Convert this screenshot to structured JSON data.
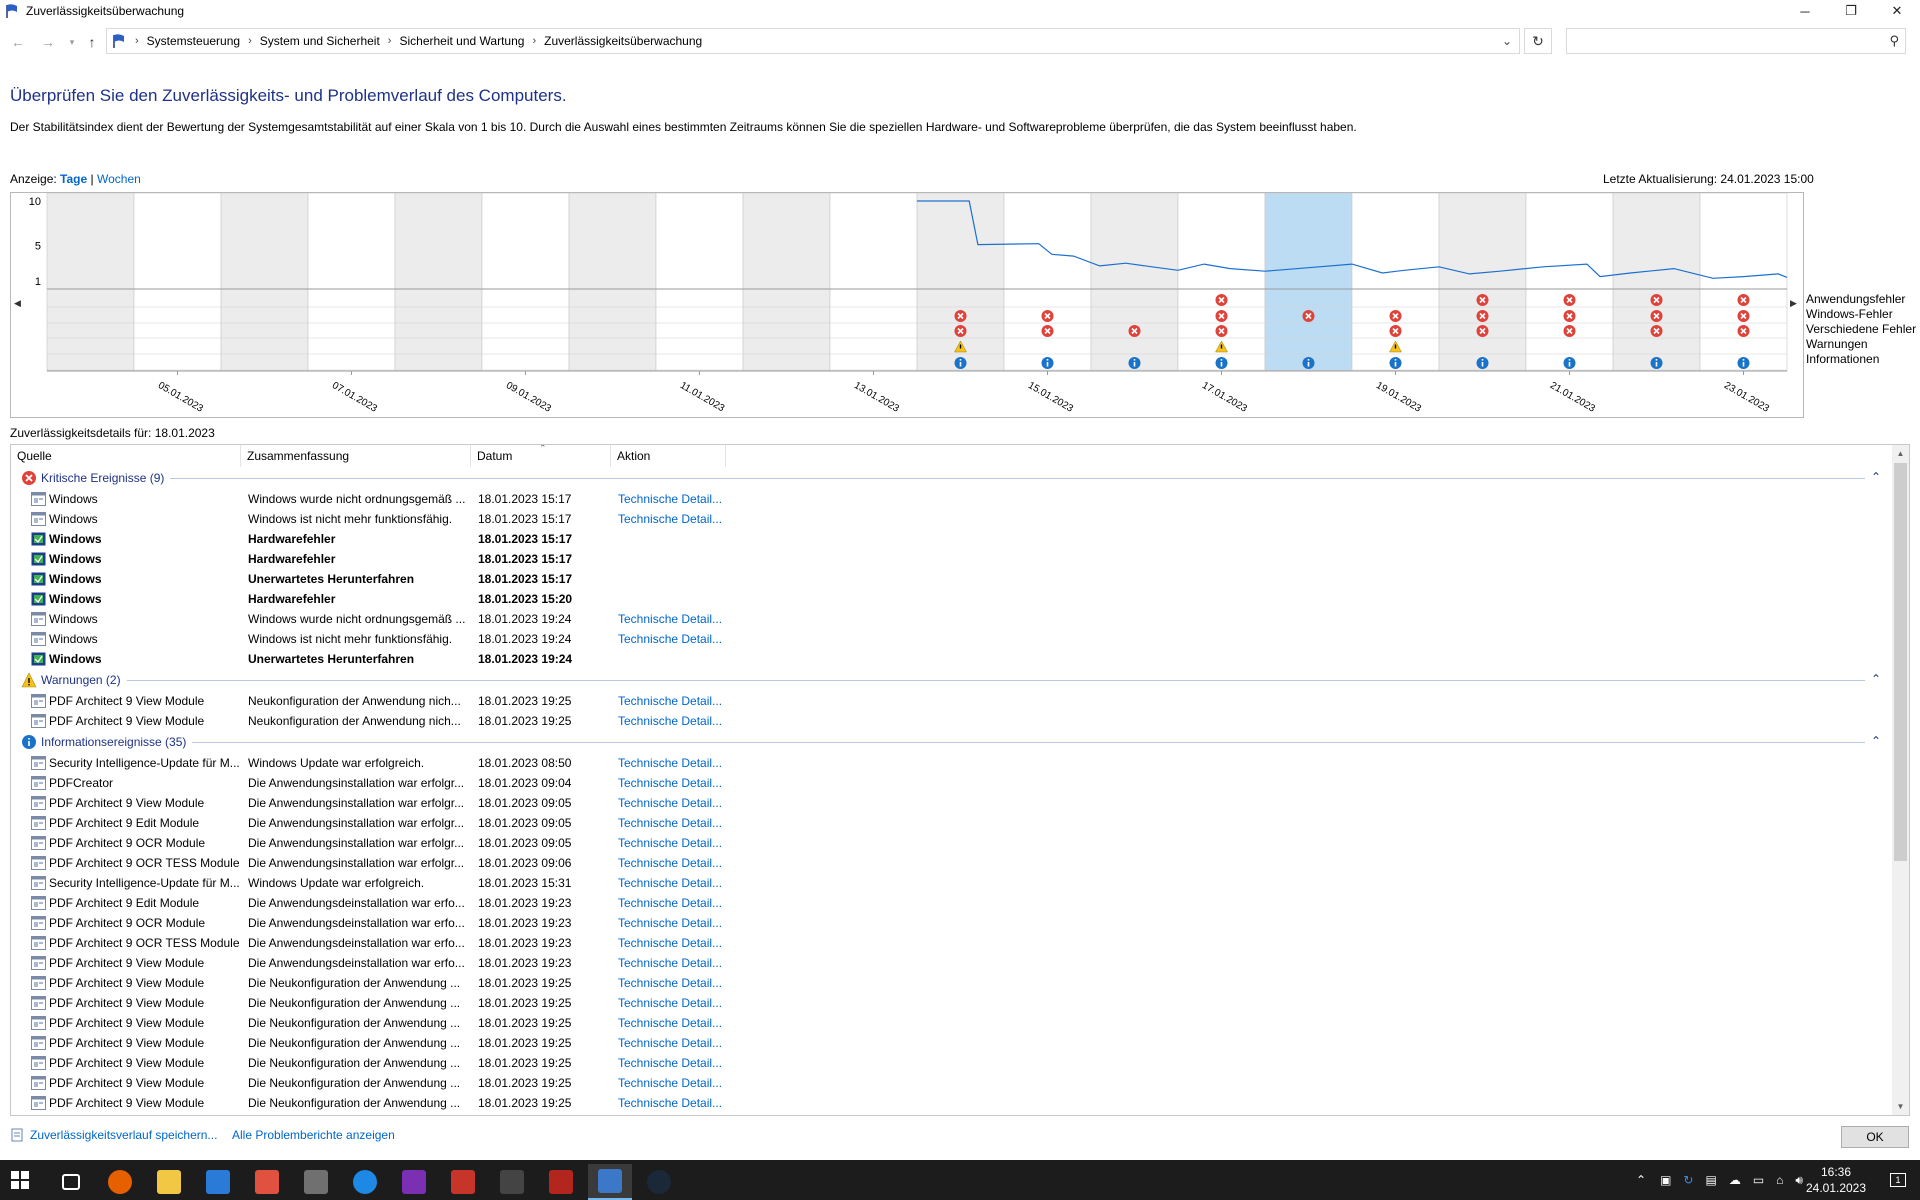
{
  "window": {
    "title": "Zuverlässigkeitsüberwachung",
    "minimize": "─",
    "maximize": "❐",
    "close": "✕"
  },
  "address": {
    "crumbs": [
      "Systemsteuerung",
      "System und Sicherheit",
      "Sicherheit und Wartung",
      "Zuverlässigkeitsüberwachung"
    ],
    "sep": "›",
    "search_placeholder": ""
  },
  "page": {
    "heading": "Überprüfen Sie den Zuverlässigkeits- und Problemverlauf des Computers.",
    "description": "Der Stabilitätsindex dient der Bewertung der Systemgesamtstabilität auf einer Skala von 1 bis 10. Durch die Auswahl eines bestimmten Zeitraums können Sie die speziellen Hardware- und Softwareprobleme überprüfen, die das System beeinflusst haben.",
    "view_label": "Anzeige:",
    "view_days": "Tage",
    "view_sep": "|",
    "view_weeks": "Wochen",
    "last_update": "Letzte Aktualisierung: 24.01.2023 15:00",
    "details_for": "Zuverlässigkeitsdetails für: 18.01.2023"
  },
  "chart_data": {
    "type": "line",
    "title": "",
    "y_ticks": [
      "10",
      "5",
      "1"
    ],
    "ylim": [
      1,
      10
    ],
    "date_labels": [
      "05.01.2023",
      "07.01.2023",
      "09.01.2023",
      "11.01.2023",
      "13.01.2023",
      "15.01.2023",
      "17.01.2023",
      "19.01.2023",
      "21.01.2023",
      "23.01.2023"
    ],
    "days": [
      "04.01.2023",
      "05.01.2023",
      "06.01.2023",
      "07.01.2023",
      "08.01.2023",
      "09.01.2023",
      "10.01.2023",
      "11.01.2023",
      "12.01.2023",
      "13.01.2023",
      "14.01.2023",
      "15.01.2023",
      "16.01.2023",
      "17.01.2023",
      "18.01.2023",
      "19.01.2023",
      "20.01.2023",
      "21.01.2023",
      "22.01.2023",
      "23.01.2023"
    ],
    "selected_day": "18.01.2023",
    "stability_series": {
      "name": "Stabilitätsindex",
      "points": [
        {
          "day": 10,
          "value": 10
        },
        {
          "day": 10.6,
          "value": 10
        },
        {
          "day": 10.7,
          "value": 5.1
        },
        {
          "day": 11.4,
          "value": 5.2
        },
        {
          "day": 11.55,
          "value": 4.0
        },
        {
          "day": 11.8,
          "value": 3.8
        },
        {
          "day": 12.1,
          "value": 2.7
        },
        {
          "day": 12.4,
          "value": 3.0
        },
        {
          "day": 12.7,
          "value": 2.6
        },
        {
          "day": 13.0,
          "value": 2.2
        },
        {
          "day": 13.3,
          "value": 2.9
        },
        {
          "day": 13.6,
          "value": 2.4
        },
        {
          "day": 14.0,
          "value": 2.1
        },
        {
          "day": 14.5,
          "value": 2.5
        },
        {
          "day": 15.0,
          "value": 2.9
        },
        {
          "day": 15.35,
          "value": 1.9
        },
        {
          "day": 15.6,
          "value": 2.2
        },
        {
          "day": 16.0,
          "value": 2.6
        },
        {
          "day": 16.35,
          "value": 1.8
        },
        {
          "day": 16.7,
          "value": 2.1
        },
        {
          "day": 17.2,
          "value": 2.6
        },
        {
          "day": 17.7,
          "value": 2.9
        },
        {
          "day": 17.85,
          "value": 1.5
        },
        {
          "day": 18.2,
          "value": 1.9
        },
        {
          "day": 18.7,
          "value": 2.4
        },
        {
          "day": 19.15,
          "value": 1.3
        },
        {
          "day": 19.5,
          "value": 1.5
        },
        {
          "day": 19.9,
          "value": 1.8
        },
        {
          "day": 20.0,
          "value": 1.4
        }
      ]
    },
    "legend": [
      "Anwendungsfehler",
      "Windows-Fehler",
      "Verschiedene Fehler",
      "Warnungen",
      "Informationen"
    ],
    "events": {
      "Anwendungsfehler": [
        13,
        16,
        17,
        18,
        19
      ],
      "Windows-Fehler": [
        10,
        11,
        13,
        14,
        15,
        16,
        17,
        18,
        19
      ],
      "Verschiedene Fehler": [
        10,
        11,
        12,
        13,
        15,
        16,
        17,
        18,
        19
      ],
      "Warnungen": [
        10,
        13,
        15
      ],
      "Informationen": [
        10,
        11,
        12,
        13,
        14,
        15,
        16,
        17,
        18,
        19
      ]
    }
  },
  "table": {
    "headers": {
      "source": "Quelle",
      "summary": "Zusammenfassung",
      "date": "Datum",
      "action": "Aktion"
    },
    "groups": [
      {
        "label": "Kritische Ereignisse (9)",
        "kind": "error",
        "rows": [
          {
            "source": "Windows",
            "summary": "Windows wurde nicht ordnungsgemäß ...",
            "date": "18.01.2023 15:17",
            "action": "Technische Detail...",
            "bold": false,
            "icon": "window"
          },
          {
            "source": "Windows",
            "summary": "Windows ist nicht mehr funktionsfähig.",
            "date": "18.01.2023 15:17",
            "action": "Technische Detail...",
            "bold": false,
            "icon": "window"
          },
          {
            "source": "Windows",
            "summary": "Hardwarefehler",
            "date": "18.01.2023 15:17",
            "action": "",
            "bold": true,
            "icon": "shield"
          },
          {
            "source": "Windows",
            "summary": "Hardwarefehler",
            "date": "18.01.2023 15:17",
            "action": "",
            "bold": true,
            "icon": "shield"
          },
          {
            "source": "Windows",
            "summary": "Unerwartetes Herunterfahren",
            "date": "18.01.2023 15:17",
            "action": "",
            "bold": true,
            "icon": "shield"
          },
          {
            "source": "Windows",
            "summary": "Hardwarefehler",
            "date": "18.01.2023 15:20",
            "action": "",
            "bold": true,
            "icon": "shield"
          },
          {
            "source": "Windows",
            "summary": "Windows wurde nicht ordnungsgemäß ...",
            "date": "18.01.2023 19:24",
            "action": "Technische Detail...",
            "bold": false,
            "icon": "window"
          },
          {
            "source": "Windows",
            "summary": "Windows ist nicht mehr funktionsfähig.",
            "date": "18.01.2023 19:24",
            "action": "Technische Detail...",
            "bold": false,
            "icon": "window"
          },
          {
            "source": "Windows",
            "summary": "Unerwartetes Herunterfahren",
            "date": "18.01.2023 19:24",
            "action": "",
            "bold": true,
            "icon": "shield"
          }
        ]
      },
      {
        "label": "Warnungen (2)",
        "kind": "warning",
        "rows": [
          {
            "source": "PDF Architect 9 View Module",
            "summary": "Neukonfiguration der Anwendung nich...",
            "date": "18.01.2023 19:25",
            "action": "Technische Detail...",
            "bold": false,
            "icon": "window"
          },
          {
            "source": "PDF Architect 9 View Module",
            "summary": "Neukonfiguration der Anwendung nich...",
            "date": "18.01.2023 19:25",
            "action": "Technische Detail...",
            "bold": false,
            "icon": "window"
          }
        ]
      },
      {
        "label": "Informationsereignisse (35)",
        "kind": "info",
        "rows": [
          {
            "source": "Security Intelligence-Update für M...",
            "summary": "Windows Update war erfolgreich.",
            "date": "18.01.2023 08:50",
            "action": "Technische Detail...",
            "bold": false,
            "icon": "window"
          },
          {
            "source": "PDFCreator",
            "summary": "Die Anwendungsinstallation war erfolgr...",
            "date": "18.01.2023 09:04",
            "action": "Technische Detail...",
            "bold": false,
            "icon": "window"
          },
          {
            "source": "PDF Architect 9 View Module",
            "summary": "Die Anwendungsinstallation war erfolgr...",
            "date": "18.01.2023 09:05",
            "action": "Technische Detail...",
            "bold": false,
            "icon": "window"
          },
          {
            "source": "PDF Architect 9 Edit Module",
            "summary": "Die Anwendungsinstallation war erfolgr...",
            "date": "18.01.2023 09:05",
            "action": "Technische Detail...",
            "bold": false,
            "icon": "window"
          },
          {
            "source": "PDF Architect 9 OCR Module",
            "summary": "Die Anwendungsinstallation war erfolgr...",
            "date": "18.01.2023 09:05",
            "action": "Technische Detail...",
            "bold": false,
            "icon": "window"
          },
          {
            "source": "PDF Architect 9 OCR TESS Module",
            "summary": "Die Anwendungsinstallation war erfolgr...",
            "date": "18.01.2023 09:06",
            "action": "Technische Detail...",
            "bold": false,
            "icon": "window"
          },
          {
            "source": "Security Intelligence-Update für M...",
            "summary": "Windows Update war erfolgreich.",
            "date": "18.01.2023 15:31",
            "action": "Technische Detail...",
            "bold": false,
            "icon": "window"
          },
          {
            "source": "PDF Architect 9 Edit Module",
            "summary": "Die Anwendungsdeinstallation war erfo...",
            "date": "18.01.2023 19:23",
            "action": "Technische Detail...",
            "bold": false,
            "icon": "window"
          },
          {
            "source": "PDF Architect 9 OCR Module",
            "summary": "Die Anwendungsdeinstallation war erfo...",
            "date": "18.01.2023 19:23",
            "action": "Technische Detail...",
            "bold": false,
            "icon": "window"
          },
          {
            "source": "PDF Architect 9 OCR TESS Module",
            "summary": "Die Anwendungsdeinstallation war erfo...",
            "date": "18.01.2023 19:23",
            "action": "Technische Detail...",
            "bold": false,
            "icon": "window"
          },
          {
            "source": "PDF Architect 9 View Module",
            "summary": "Die Anwendungsdeinstallation war erfo...",
            "date": "18.01.2023 19:23",
            "action": "Technische Detail...",
            "bold": false,
            "icon": "window"
          },
          {
            "source": "PDF Architect 9 View Module",
            "summary": "Die Neukonfiguration der Anwendung ...",
            "date": "18.01.2023 19:25",
            "action": "Technische Detail...",
            "bold": false,
            "icon": "window"
          },
          {
            "source": "PDF Architect 9 View Module",
            "summary": "Die Neukonfiguration der Anwendung ...",
            "date": "18.01.2023 19:25",
            "action": "Technische Detail...",
            "bold": false,
            "icon": "window"
          },
          {
            "source": "PDF Architect 9 View Module",
            "summary": "Die Neukonfiguration der Anwendung ...",
            "date": "18.01.2023 19:25",
            "action": "Technische Detail...",
            "bold": false,
            "icon": "window"
          },
          {
            "source": "PDF Architect 9 View Module",
            "summary": "Die Neukonfiguration der Anwendung ...",
            "date": "18.01.2023 19:25",
            "action": "Technische Detail...",
            "bold": false,
            "icon": "window"
          },
          {
            "source": "PDF Architect 9 View Module",
            "summary": "Die Neukonfiguration der Anwendung ...",
            "date": "18.01.2023 19:25",
            "action": "Technische Detail...",
            "bold": false,
            "icon": "window"
          },
          {
            "source": "PDF Architect 9 View Module",
            "summary": "Die Neukonfiguration der Anwendung ...",
            "date": "18.01.2023 19:25",
            "action": "Technische Detail...",
            "bold": false,
            "icon": "window"
          },
          {
            "source": "PDF Architect 9 View Module",
            "summary": "Die Neukonfiguration der Anwendung ...",
            "date": "18.01.2023 19:25",
            "action": "Technische Detail...",
            "bold": false,
            "icon": "window"
          }
        ]
      }
    ]
  },
  "footer": {
    "save_link": "Zuverlässigkeitsverlauf speichern...",
    "all_reports": "Alle Problemberichte anzeigen",
    "ok": "OK"
  },
  "taskbar": {
    "apps": [
      "start-icon",
      "task-view-icon",
      "firefox-icon",
      "file-explorer-icon",
      "mail-icon",
      "snipping-icon",
      "calculator-icon",
      "edge-icon",
      "onenote-icon",
      "pdf-tool-icon",
      "inkscape-icon",
      "game-icon",
      "reliability-monitor-icon",
      "steam-icon"
    ],
    "time": "16:36",
    "date": "24.01.2023",
    "notifications": "1"
  },
  "colors": {
    "accent": "#1e3287",
    "link": "#0066cc",
    "selection": "#bcdcf4",
    "error": "#e0423a",
    "warning": "#f4c21b",
    "info": "#1a73c9"
  }
}
